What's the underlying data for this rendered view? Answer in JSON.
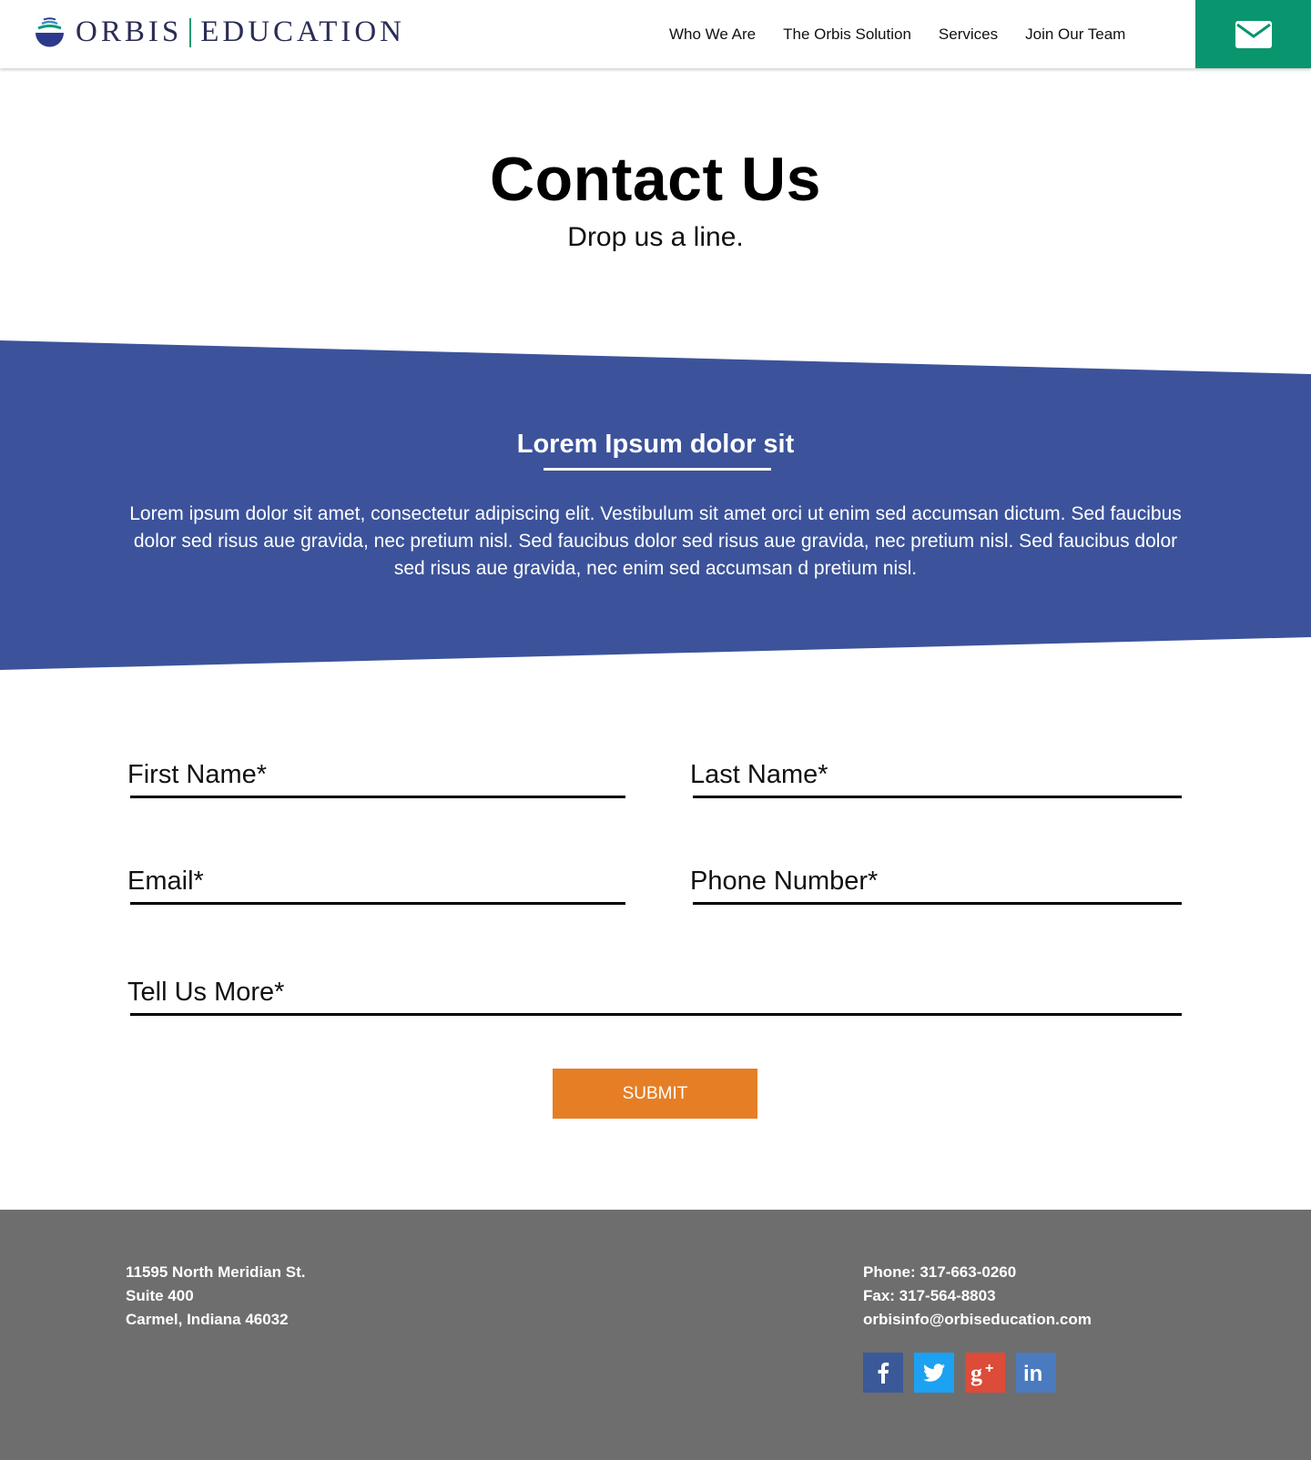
{
  "header": {
    "logo_left": "ORBIS",
    "logo_right": "EDUCATION",
    "nav": [
      "Who We Are",
      "The Orbis Solution",
      "Services",
      "Join Our Team"
    ],
    "mail_icon": "envelope-icon",
    "mail_color": "#09956d"
  },
  "hero": {
    "title": "Contact Us",
    "subtitle": "Drop us a line."
  },
  "band": {
    "title": "Lorem Ipsum dolor sit",
    "text": "Lorem ipsum dolor sit amet, consectetur adipiscing elit. Vestibulum sit amet orci ut enim sed accumsan dictum. Sed faucibus dolor sed risus aue gravida, nec pretium nisl.  Sed faucibus dolor sed risus aue gravida, nec pretium nisl.   Sed faucibus dolor sed risus aue gravida, nec enim sed accumsan d pretium nisl.",
    "color": "#3c539b"
  },
  "form": {
    "first_name_placeholder": "First Name*",
    "last_name_placeholder": "Last Name*",
    "email_placeholder": "Email*",
    "phone_placeholder": "Phone Number*",
    "more_placeholder": "Tell Us More*",
    "submit_label": "SUBMIT",
    "submit_color": "#e67e26"
  },
  "footer": {
    "address": [
      "11595 North Meridian St.",
      "Suite 400",
      "Carmel, Indiana 46032"
    ],
    "phone": "Phone: 317-663-0260",
    "fax": "Fax: 317-564-8803",
    "email": "orbisinfo@orbiseducation.com",
    "background": "#6e6e6e",
    "socials": [
      {
        "icon": "facebook-icon",
        "glyph": "f",
        "color": "#3b5998"
      },
      {
        "icon": "twitter-icon",
        "glyph": "t",
        "color": "#1da1f2"
      },
      {
        "icon": "google-plus-icon",
        "glyph": "g+",
        "color": "#dd4b39"
      },
      {
        "icon": "linkedin-icon",
        "glyph": "in",
        "color": "#4a7bbf"
      }
    ]
  }
}
